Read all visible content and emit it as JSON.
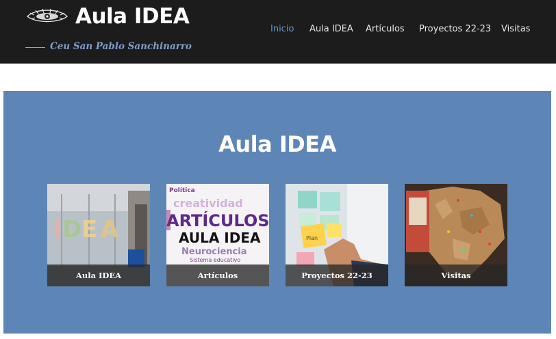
{
  "site": {
    "title": "Aula IDEA",
    "tagline": "Ceu San Pablo Sanchinarro"
  },
  "nav": {
    "items": [
      {
        "label": "Inicio",
        "active": true
      },
      {
        "label": "Aula IDEA",
        "active": false
      },
      {
        "label": "Artículos",
        "active": false
      },
      {
        "label": "Proyectos 22-23",
        "active": false
      },
      {
        "label": "Visitas",
        "active": false
      }
    ]
  },
  "hero": {
    "title": "Aula IDEA",
    "cards": [
      {
        "caption": "Aula IDEA",
        "image": "classroom-glass-wall-idea-photo"
      },
      {
        "caption": "Artículos",
        "image": "word-cloud-articulos-aula-idea",
        "image_text": [
          "ARTÍCULOS",
          "AULA IDEA",
          "Neurociencia",
          "creatividad",
          "Política",
          "Sistema educativo"
        ]
      },
      {
        "caption": "Proyectos 22-23",
        "image": "sticky-notes-whiteboard-photo",
        "image_text": [
          "Plan"
        ]
      },
      {
        "caption": "Visitas",
        "image": "cork-world-map-pins-photo"
      }
    ]
  },
  "colors": {
    "header_bg": "#1c1c1c",
    "nav_active": "#6a97cd",
    "tagline": "#7d9fcf",
    "hero_bg": "#5d86b7",
    "caption_bg": "rgba(40,40,40,0.78)"
  }
}
